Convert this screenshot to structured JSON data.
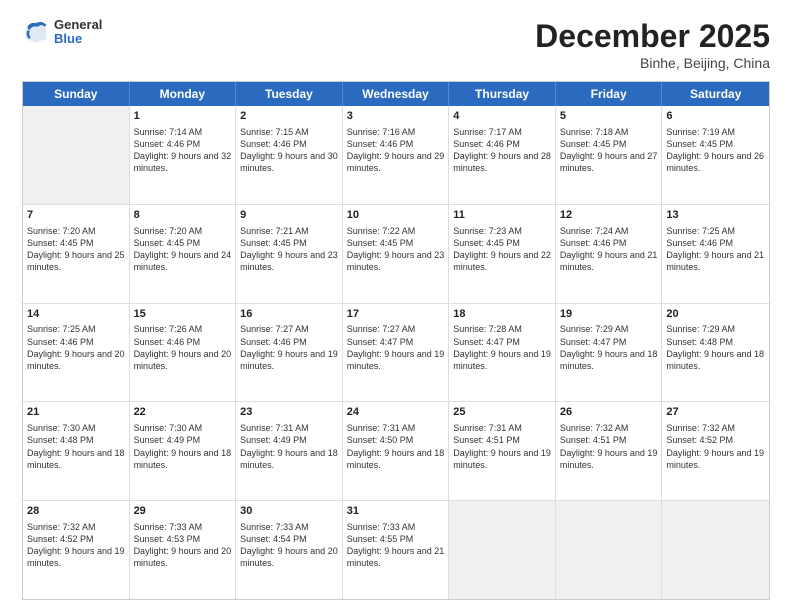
{
  "header": {
    "logo": {
      "general": "General",
      "blue": "Blue"
    },
    "title": "December 2025",
    "location": "Binhe, Beijing, China"
  },
  "weekdays": [
    "Sunday",
    "Monday",
    "Tuesday",
    "Wednesday",
    "Thursday",
    "Friday",
    "Saturday"
  ],
  "rows": [
    [
      {
        "day": "",
        "sunrise": "",
        "sunset": "",
        "daylight": "",
        "empty": true
      },
      {
        "day": "1",
        "sunrise": "Sunrise: 7:14 AM",
        "sunset": "Sunset: 4:46 PM",
        "daylight": "Daylight: 9 hours and 32 minutes.",
        "empty": false
      },
      {
        "day": "2",
        "sunrise": "Sunrise: 7:15 AM",
        "sunset": "Sunset: 4:46 PM",
        "daylight": "Daylight: 9 hours and 30 minutes.",
        "empty": false
      },
      {
        "day": "3",
        "sunrise": "Sunrise: 7:16 AM",
        "sunset": "Sunset: 4:46 PM",
        "daylight": "Daylight: 9 hours and 29 minutes.",
        "empty": false
      },
      {
        "day": "4",
        "sunrise": "Sunrise: 7:17 AM",
        "sunset": "Sunset: 4:46 PM",
        "daylight": "Daylight: 9 hours and 28 minutes.",
        "empty": false
      },
      {
        "day": "5",
        "sunrise": "Sunrise: 7:18 AM",
        "sunset": "Sunset: 4:45 PM",
        "daylight": "Daylight: 9 hours and 27 minutes.",
        "empty": false
      },
      {
        "day": "6",
        "sunrise": "Sunrise: 7:19 AM",
        "sunset": "Sunset: 4:45 PM",
        "daylight": "Daylight: 9 hours and 26 minutes.",
        "empty": false
      }
    ],
    [
      {
        "day": "7",
        "sunrise": "Sunrise: 7:20 AM",
        "sunset": "Sunset: 4:45 PM",
        "daylight": "Daylight: 9 hours and 25 minutes.",
        "empty": false
      },
      {
        "day": "8",
        "sunrise": "Sunrise: 7:20 AM",
        "sunset": "Sunset: 4:45 PM",
        "daylight": "Daylight: 9 hours and 24 minutes.",
        "empty": false
      },
      {
        "day": "9",
        "sunrise": "Sunrise: 7:21 AM",
        "sunset": "Sunset: 4:45 PM",
        "daylight": "Daylight: 9 hours and 23 minutes.",
        "empty": false
      },
      {
        "day": "10",
        "sunrise": "Sunrise: 7:22 AM",
        "sunset": "Sunset: 4:45 PM",
        "daylight": "Daylight: 9 hours and 23 minutes.",
        "empty": false
      },
      {
        "day": "11",
        "sunrise": "Sunrise: 7:23 AM",
        "sunset": "Sunset: 4:45 PM",
        "daylight": "Daylight: 9 hours and 22 minutes.",
        "empty": false
      },
      {
        "day": "12",
        "sunrise": "Sunrise: 7:24 AM",
        "sunset": "Sunset: 4:46 PM",
        "daylight": "Daylight: 9 hours and 21 minutes.",
        "empty": false
      },
      {
        "day": "13",
        "sunrise": "Sunrise: 7:25 AM",
        "sunset": "Sunset: 4:46 PM",
        "daylight": "Daylight: 9 hours and 21 minutes.",
        "empty": false
      }
    ],
    [
      {
        "day": "14",
        "sunrise": "Sunrise: 7:25 AM",
        "sunset": "Sunset: 4:46 PM",
        "daylight": "Daylight: 9 hours and 20 minutes.",
        "empty": false
      },
      {
        "day": "15",
        "sunrise": "Sunrise: 7:26 AM",
        "sunset": "Sunset: 4:46 PM",
        "daylight": "Daylight: 9 hours and 20 minutes.",
        "empty": false
      },
      {
        "day": "16",
        "sunrise": "Sunrise: 7:27 AM",
        "sunset": "Sunset: 4:46 PM",
        "daylight": "Daylight: 9 hours and 19 minutes.",
        "empty": false
      },
      {
        "day": "17",
        "sunrise": "Sunrise: 7:27 AM",
        "sunset": "Sunset: 4:47 PM",
        "daylight": "Daylight: 9 hours and 19 minutes.",
        "empty": false
      },
      {
        "day": "18",
        "sunrise": "Sunrise: 7:28 AM",
        "sunset": "Sunset: 4:47 PM",
        "daylight": "Daylight: 9 hours and 19 minutes.",
        "empty": false
      },
      {
        "day": "19",
        "sunrise": "Sunrise: 7:29 AM",
        "sunset": "Sunset: 4:47 PM",
        "daylight": "Daylight: 9 hours and 18 minutes.",
        "empty": false
      },
      {
        "day": "20",
        "sunrise": "Sunrise: 7:29 AM",
        "sunset": "Sunset: 4:48 PM",
        "daylight": "Daylight: 9 hours and 18 minutes.",
        "empty": false
      }
    ],
    [
      {
        "day": "21",
        "sunrise": "Sunrise: 7:30 AM",
        "sunset": "Sunset: 4:48 PM",
        "daylight": "Daylight: 9 hours and 18 minutes.",
        "empty": false
      },
      {
        "day": "22",
        "sunrise": "Sunrise: 7:30 AM",
        "sunset": "Sunset: 4:49 PM",
        "daylight": "Daylight: 9 hours and 18 minutes.",
        "empty": false
      },
      {
        "day": "23",
        "sunrise": "Sunrise: 7:31 AM",
        "sunset": "Sunset: 4:49 PM",
        "daylight": "Daylight: 9 hours and 18 minutes.",
        "empty": false
      },
      {
        "day": "24",
        "sunrise": "Sunrise: 7:31 AM",
        "sunset": "Sunset: 4:50 PM",
        "daylight": "Daylight: 9 hours and 18 minutes.",
        "empty": false
      },
      {
        "day": "25",
        "sunrise": "Sunrise: 7:31 AM",
        "sunset": "Sunset: 4:51 PM",
        "daylight": "Daylight: 9 hours and 19 minutes.",
        "empty": false
      },
      {
        "day": "26",
        "sunrise": "Sunrise: 7:32 AM",
        "sunset": "Sunset: 4:51 PM",
        "daylight": "Daylight: 9 hours and 19 minutes.",
        "empty": false
      },
      {
        "day": "27",
        "sunrise": "Sunrise: 7:32 AM",
        "sunset": "Sunset: 4:52 PM",
        "daylight": "Daylight: 9 hours and 19 minutes.",
        "empty": false
      }
    ],
    [
      {
        "day": "28",
        "sunrise": "Sunrise: 7:32 AM",
        "sunset": "Sunset: 4:52 PM",
        "daylight": "Daylight: 9 hours and 19 minutes.",
        "empty": false
      },
      {
        "day": "29",
        "sunrise": "Sunrise: 7:33 AM",
        "sunset": "Sunset: 4:53 PM",
        "daylight": "Daylight: 9 hours and 20 minutes.",
        "empty": false
      },
      {
        "day": "30",
        "sunrise": "Sunrise: 7:33 AM",
        "sunset": "Sunset: 4:54 PM",
        "daylight": "Daylight: 9 hours and 20 minutes.",
        "empty": false
      },
      {
        "day": "31",
        "sunrise": "Sunrise: 7:33 AM",
        "sunset": "Sunset: 4:55 PM",
        "daylight": "Daylight: 9 hours and 21 minutes.",
        "empty": false
      },
      {
        "day": "",
        "sunrise": "",
        "sunset": "",
        "daylight": "",
        "empty": true
      },
      {
        "day": "",
        "sunrise": "",
        "sunset": "",
        "daylight": "",
        "empty": true
      },
      {
        "day": "",
        "sunrise": "",
        "sunset": "",
        "daylight": "",
        "empty": true
      }
    ]
  ]
}
